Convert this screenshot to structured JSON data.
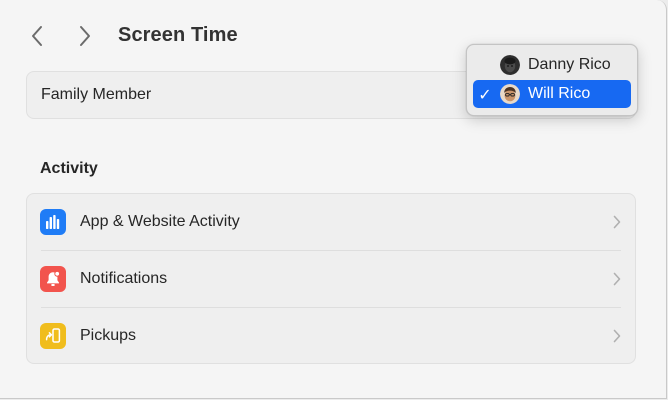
{
  "header": {
    "title": "Screen Time",
    "back_icon": "chevron-left-icon",
    "forward_icon": "chevron-right-icon"
  },
  "family_member": {
    "label": "Family Member",
    "popup": {
      "options": [
        {
          "name": "Danny Rico",
          "selected": false,
          "avatar_icon": "memoji-avatar-dark"
        },
        {
          "name": "Will Rico",
          "selected": true,
          "avatar_icon": "memoji-avatar-light"
        }
      ],
      "checkmark": "✓",
      "highlight_color": "#1769f2"
    }
  },
  "activity": {
    "section_title": "Activity",
    "rows": [
      {
        "label": "App & Website Activity",
        "icon": "bar-chart-icon",
        "color": "#1f7cf6"
      },
      {
        "label": "Notifications",
        "icon": "bell-icon",
        "color": "#f2544d"
      },
      {
        "label": "Pickups",
        "icon": "pickup-phone-icon",
        "color": "#f0bd1d"
      }
    ]
  }
}
